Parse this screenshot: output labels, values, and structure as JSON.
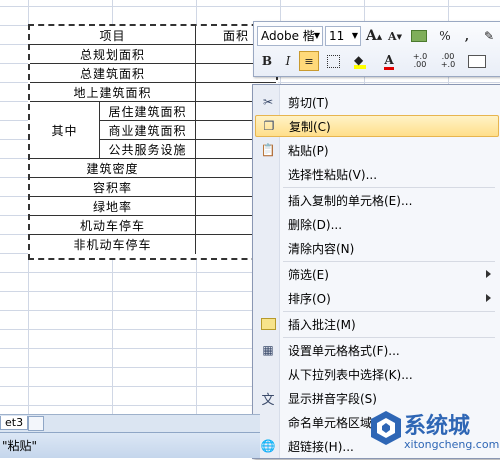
{
  "table": {
    "header_item": "项目",
    "header_area": "面积",
    "rows": [
      "总规划面积",
      "总建筑面积",
      "地上建筑面积"
    ],
    "group_label": "其中",
    "group_rows": [
      "居住建筑面积",
      "商业建筑面积",
      "公共服务设施"
    ],
    "rows_after": [
      "建筑密度",
      "容积率",
      "绿地率",
      "机动车停车",
      "非机动车停车"
    ]
  },
  "mini_toolbar": {
    "font_name": "Adobe 楷",
    "font_size": "11",
    "grow_font": "A",
    "shrink_font": "A",
    "percent": "%",
    "comma": ",",
    "bold": "B",
    "italic": "I",
    "font_color": "A",
    "inc_decimal": "+.0",
    "inc_decimal2": ".00",
    "dec_decimal": ".00",
    "dec_decimal2": "+.0"
  },
  "context_menu": {
    "items": [
      {
        "label": "剪切(T)",
        "icon": "scissors-icon"
      },
      {
        "label": "复制(C)",
        "icon": "copy-icon",
        "highlighted": true
      },
      {
        "label": "粘贴(P)",
        "icon": "paste-icon"
      },
      {
        "label": "选择性粘贴(V)...",
        "icon": ""
      },
      {
        "label": "插入复制的单元格(E)...",
        "icon": ""
      },
      {
        "label": "删除(D)...",
        "icon": ""
      },
      {
        "label": "清除内容(N)",
        "icon": ""
      },
      {
        "label": "筛选(E)",
        "icon": "",
        "submenu": true
      },
      {
        "label": "排序(O)",
        "icon": "",
        "submenu": true
      },
      {
        "label": "插入批注(M)",
        "icon": "comment-icon"
      },
      {
        "label": "设置单元格格式(F)...",
        "icon": "format-cells-icon"
      },
      {
        "label": "从下拉列表中选择(K)...",
        "icon": ""
      },
      {
        "label": "显示拼音字段(S)",
        "icon": "phonetic-icon"
      },
      {
        "label": "命名单元格区域(R)...",
        "icon": ""
      },
      {
        "label": "超链接(H)...",
        "icon": "hyperlink-icon"
      }
    ]
  },
  "sheet_tab": "et3",
  "status_text": "\"粘贴\"",
  "watermark": {
    "brand": "系统城",
    "url": "xitongcheng.com"
  },
  "colors": {
    "highlight": "#ffdf8a",
    "accent_blue": "#2e66b5"
  }
}
